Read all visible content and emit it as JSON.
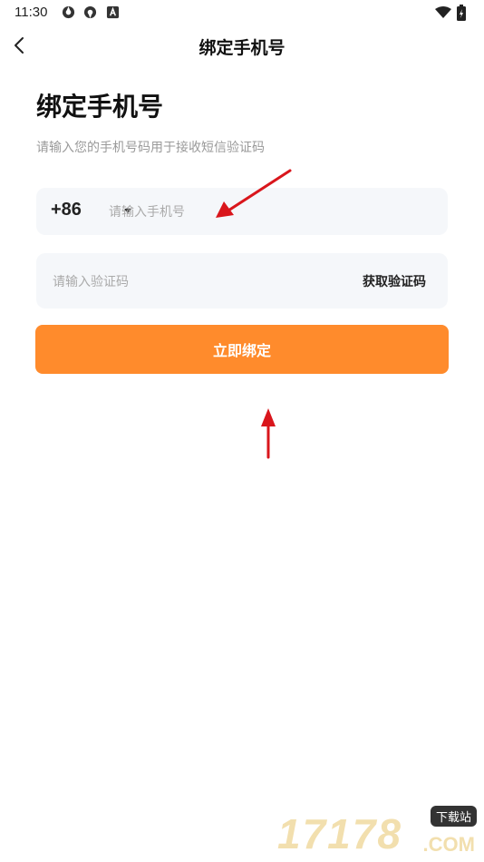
{
  "status_bar": {
    "time": "11:30",
    "left_icons": [
      "sync-icon",
      "sync-icon",
      "app-a-icon"
    ],
    "right_icons": [
      "wifi-icon",
      "battery-charging-icon"
    ]
  },
  "nav": {
    "title": "绑定手机号",
    "back_icon": "chevron-left-icon"
  },
  "page": {
    "heading": "绑定手机号",
    "subtitle": "请输入您的手机号码用于接收短信验证码"
  },
  "phone_field": {
    "country_code": "+86",
    "placeholder": "请输入手机号",
    "value": ""
  },
  "code_field": {
    "placeholder": "请输入验证码",
    "value": "",
    "get_code_label": "获取验证码"
  },
  "submit": {
    "label": "立即绑定"
  },
  "watermark": {
    "number": "17178",
    "badge": "下载站",
    "suffix": ".COM"
  },
  "colors": {
    "accent": "#ff8b2c",
    "field_bg": "#f5f7fa",
    "annotation_arrow": "#d9161c"
  }
}
